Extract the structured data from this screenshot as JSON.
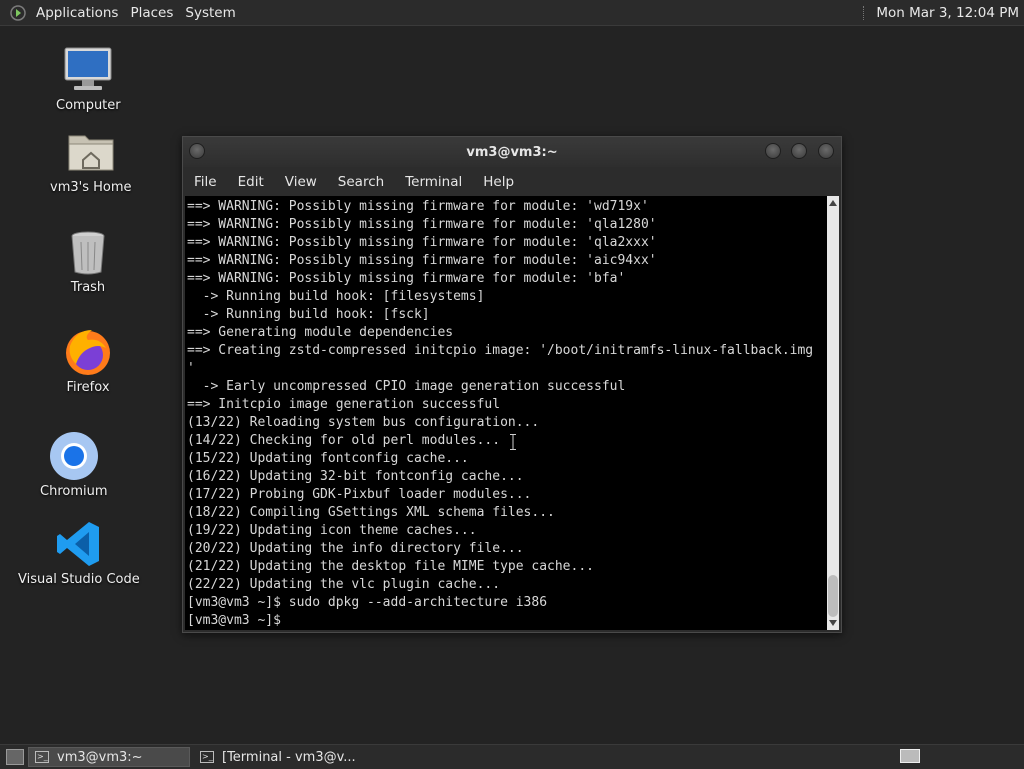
{
  "top_panel": {
    "menus": [
      "Applications",
      "Places",
      "System"
    ],
    "clock": "Mon Mar  3, 12:04 PM"
  },
  "desktop_icons": [
    {
      "label": "Computer",
      "icon": "computer-icon"
    },
    {
      "label": "vm3's Home",
      "icon": "home-folder-icon"
    },
    {
      "label": "Trash",
      "icon": "trash-icon"
    },
    {
      "label": "Firefox",
      "icon": "firefox-icon"
    },
    {
      "label": "Chromium",
      "icon": "chromium-icon"
    },
    {
      "label": "Visual Studio Code",
      "icon": "vscode-icon"
    }
  ],
  "window": {
    "title": "vm3@vm3:~",
    "menu": [
      "File",
      "Edit",
      "View",
      "Search",
      "Terminal",
      "Help"
    ]
  },
  "terminal": {
    "lines": [
      "==> WARNING: Possibly missing firmware for module: 'wd719x'",
      "==> WARNING: Possibly missing firmware for module: 'qla1280'",
      "==> WARNING: Possibly missing firmware for module: 'qla2xxx'",
      "==> WARNING: Possibly missing firmware for module: 'aic94xx'",
      "==> WARNING: Possibly missing firmware for module: 'bfa'",
      "  -> Running build hook: [filesystems]",
      "  -> Running build hook: [fsck]",
      "==> Generating module dependencies",
      "==> Creating zstd-compressed initcpio image: '/boot/initramfs-linux-fallback.img",
      "'",
      "  -> Early uncompressed CPIO image generation successful",
      "==> Initcpio image generation successful",
      "(13/22) Reloading system bus configuration...",
      "(14/22) Checking for old perl modules...",
      "(15/22) Updating fontconfig cache...",
      "(16/22) Updating 32-bit fontconfig cache...",
      "(17/22) Probing GDK-Pixbuf loader modules...",
      "(18/22) Compiling GSettings XML schema files...",
      "(19/22) Updating icon theme caches...",
      "(20/22) Updating the info directory file...",
      "(21/22) Updating the desktop file MIME type cache...",
      "(22/22) Updating the vlc plugin cache...",
      "[vm3@vm3 ~]$ sudo dpkg --add-architecture i386",
      "[vm3@vm3 ~]$ "
    ]
  },
  "taskbar": {
    "tasks": [
      {
        "label": "vm3@vm3:~",
        "active": true
      },
      {
        "label": "[Terminal - vm3@v...",
        "active": false
      }
    ]
  },
  "colors": {
    "panel_bg": "#2b2b2b",
    "desktop_bg": "#232323",
    "terminal_bg": "#000000",
    "terminal_fg": "#d8d8d8"
  }
}
